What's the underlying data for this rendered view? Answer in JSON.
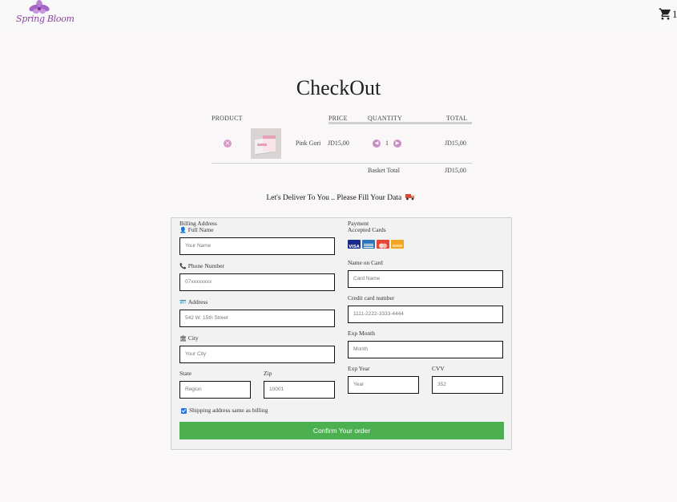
{
  "brand": {
    "logo_text": "Spring Bloom",
    "accent": "#8e3fa6"
  },
  "header": {
    "cart_icon": "shopping-cart-icon",
    "cart_count": "1"
  },
  "page_title": "CheckOut",
  "cart": {
    "columns": {
      "product": "PRODUCT",
      "price": "PRICE",
      "quantity": "QUANTITY",
      "total": "TOTAL"
    },
    "items": [
      {
        "name": "Pink Gori",
        "price": "JD15,00",
        "quantity": "1",
        "total": "JD15,00"
      }
    ],
    "basket_total_label": "Basket Total",
    "basket_total_value": "JD15,00"
  },
  "deliver_text": "Let's Deliver To You .. Please Fill Your Data",
  "billing": {
    "heading": "Billing Address",
    "full_name": {
      "label": "Full Name",
      "placeholder": "Your Name",
      "icon": "user-icon"
    },
    "phone": {
      "label": "Phone Number",
      "placeholder": "07xxxxxxxx",
      "icon": "phone-icon"
    },
    "address": {
      "label": "Address",
      "placeholder": "542 W. 15th Street",
      "icon": "id-card-icon"
    },
    "city": {
      "label": "City",
      "placeholder": "Your City",
      "icon": "institution-icon"
    },
    "state": {
      "label": "State",
      "placeholder": "Region"
    },
    "zip": {
      "label": "Zip",
      "placeholder": "10001"
    }
  },
  "payment": {
    "heading": "Payment",
    "accepted_cards_label": "Accepted Cards",
    "cards": [
      "visa",
      "amex",
      "mastercard",
      "discover"
    ],
    "name_on_card": {
      "label": "Name on Card",
      "placeholder": "Card Name"
    },
    "card_number": {
      "label": "Credit card number",
      "placeholder": "1111-2222-3333-4444"
    },
    "exp_month": {
      "label": "Exp Month",
      "placeholder": "Month"
    },
    "exp_year": {
      "label": "Exp Year",
      "placeholder": "Year"
    },
    "cvv": {
      "label": "CVV",
      "placeholder": "352"
    }
  },
  "shipping_same_label": "Shipping address same as billing",
  "shipping_same_checked": true,
  "confirm_label": "Confirm Your order",
  "colors": {
    "confirm_button": "#4caf50",
    "qty_button": "#c98ec4",
    "remove_button": "#d99ac7"
  }
}
